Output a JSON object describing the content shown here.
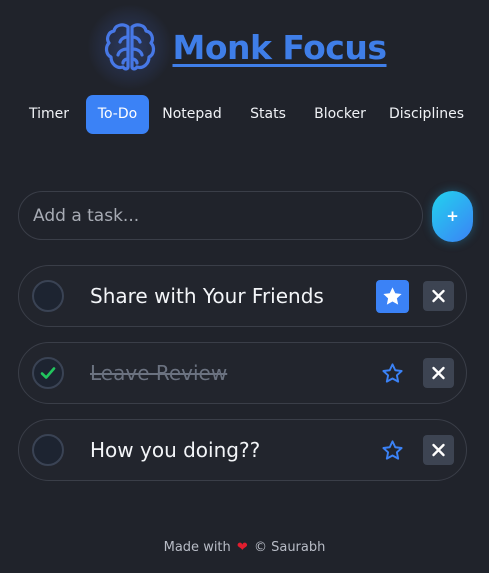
{
  "app": {
    "title": "Monk Focus",
    "logo_icon": "brain-icon",
    "accent": "#3b82f6"
  },
  "nav": {
    "tabs": [
      {
        "label": "Timer",
        "active": false
      },
      {
        "label": "To-Do",
        "active": true
      },
      {
        "label": "Notepad",
        "active": false
      },
      {
        "label": "Stats",
        "active": false
      },
      {
        "label": "Blocker",
        "active": false
      },
      {
        "label": "Disciplines",
        "active": false
      }
    ]
  },
  "add_task": {
    "placeholder": "Add a task...",
    "value": "",
    "button_label": "+"
  },
  "tasks": [
    {
      "text": "Share with Your Friends",
      "completed": false,
      "starred": true
    },
    {
      "text": "Leave Review",
      "completed": true,
      "starred": false
    },
    {
      "text": "How you doing??",
      "completed": false,
      "starred": false
    }
  ],
  "footer": {
    "prefix": "Made with",
    "heart": "❤",
    "suffix": "© Saurabh"
  }
}
